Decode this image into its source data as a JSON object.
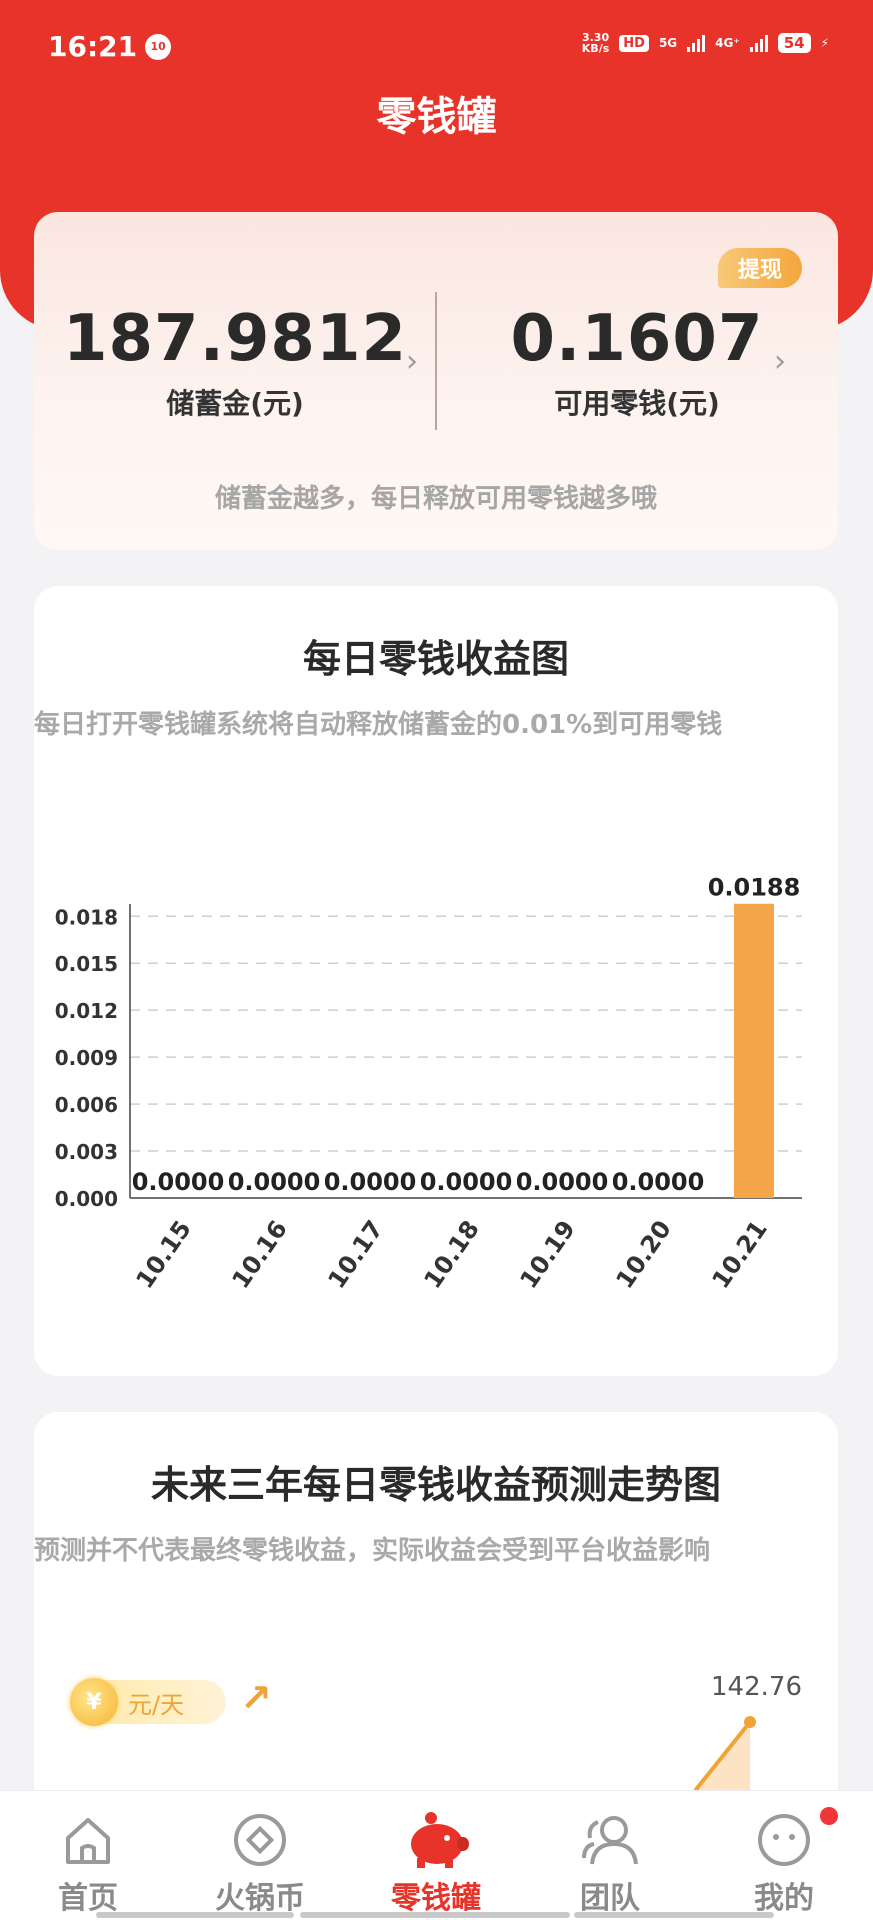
{
  "status_bar": {
    "time": "16:21",
    "notif_badge": "10",
    "net_speed_value": "3.30",
    "net_speed_unit": "KB/s",
    "hd_label": "HD",
    "net_label_1": "5G",
    "net_label_2": "4G⁺",
    "battery": "54"
  },
  "header": {
    "title": "零钱罐"
  },
  "balance": {
    "withdraw_label": "提现",
    "savings_value": "187.9812",
    "savings_label": "储蓄金(元)",
    "available_value": "0.1607",
    "available_label": "可用零钱(元)",
    "chevron": "›",
    "tip": "储蓄金越多，每日释放可用零钱越多哦"
  },
  "daily_chart": {
    "title": "每日零钱收益图",
    "subtitle": "每日打开零钱罐系统将自动释放储蓄金的0.01%到可用零钱"
  },
  "chart_data": {
    "type": "bar",
    "categories": [
      "10.15",
      "10.16",
      "10.17",
      "10.18",
      "10.19",
      "10.20",
      "10.21"
    ],
    "values": [
      0.0,
      0.0,
      0.0,
      0.0,
      0.0,
      0.0,
      0.0188
    ],
    "data_labels": [
      "0.0000",
      "0.0000",
      "0.0000",
      "0.0000",
      "0.0000",
      "0.0000",
      "0.0188"
    ],
    "yticks": [
      "0.000",
      "0.003",
      "0.006",
      "0.009",
      "0.012",
      "0.015",
      "0.018"
    ],
    "ylim": [
      0,
      0.0207
    ],
    "grid": true,
    "bar_color": "#f5a54a"
  },
  "forecast": {
    "title": "未来三年每日零钱收益预测走势图",
    "subtitle": "预测并不代表最终零钱收益，实际收益会受到平台收益影响",
    "unit_label": "元/天",
    "max_value": "142.76",
    "accent_color": "#f0a437"
  },
  "nav": {
    "items": [
      {
        "label": "首页"
      },
      {
        "label": "火锅币"
      },
      {
        "label": "零钱罐"
      },
      {
        "label": "团队"
      },
      {
        "label": "我的"
      }
    ],
    "active_color": "#e8332a"
  }
}
